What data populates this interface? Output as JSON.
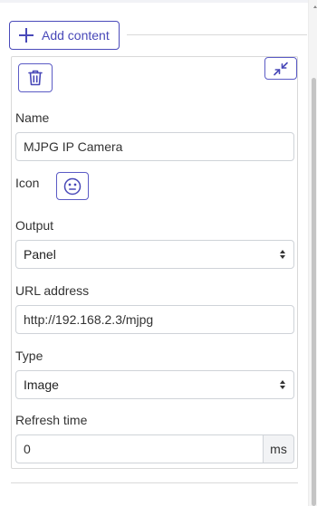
{
  "toolbar": {
    "add_content_label": "Add content"
  },
  "item": {
    "name": {
      "label": "Name",
      "value": "MJPG IP Camera"
    },
    "icon": {
      "label": "Icon",
      "value_icon": "neutral-face-icon"
    },
    "output": {
      "label": "Output",
      "value": "Panel"
    },
    "url": {
      "label": "URL address",
      "value": "http://192.168.2.3/mjpg"
    },
    "type": {
      "label": "Type",
      "value": "Image"
    },
    "refresh": {
      "label": "Refresh time",
      "value": "0",
      "unit": "ms"
    }
  },
  "icons": {
    "delete": "trash-icon",
    "collapse": "collapse-arrows-icon",
    "add": "plus-icon"
  },
  "colors": {
    "accent": "#4848b8",
    "border": "#cfd3d8",
    "text": "#333333"
  }
}
